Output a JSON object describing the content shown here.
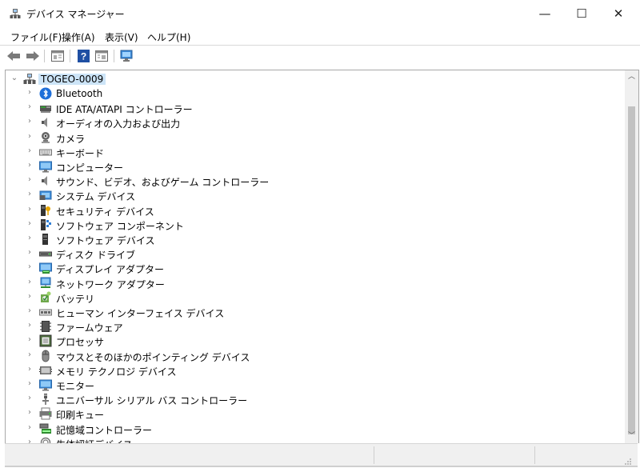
{
  "window": {
    "title": "デバイス マネージャー",
    "minimize": "—",
    "maximize": "☐",
    "close": "✕"
  },
  "menu": [
    {
      "label": "ファイル(F)"
    },
    {
      "label": "操作(A)"
    },
    {
      "label": "表示(V)"
    },
    {
      "label": "ヘルプ(H)"
    }
  ],
  "toolbar": {
    "buttons": [
      {
        "name": "back-icon"
      },
      {
        "name": "forward-icon"
      },
      {
        "name": "properties-view-icon"
      },
      {
        "name": "help-icon"
      },
      {
        "name": "action-view-icon"
      },
      {
        "name": "monitor-scan-icon"
      }
    ]
  },
  "tree": {
    "root": {
      "label": "TOGEO-0009",
      "icon": "computer-network-icon",
      "expanded": true
    },
    "items": [
      {
        "label": "Bluetooth",
        "icon": "bluetooth-icon"
      },
      {
        "label": "IDE ATA/ATAPI コントローラー",
        "icon": "ide-controller-icon"
      },
      {
        "label": "オーディオの入力および出力",
        "icon": "speaker-icon"
      },
      {
        "label": "カメラ",
        "icon": "camera-icon"
      },
      {
        "label": "キーボード",
        "icon": "keyboard-icon"
      },
      {
        "label": "コンピューター",
        "icon": "computer-icon"
      },
      {
        "label": "サウンド、ビデオ、およびゲーム コントローラー",
        "icon": "sound-icon"
      },
      {
        "label": "システム デバイス",
        "icon": "system-device-icon"
      },
      {
        "label": "セキュリティ デバイス",
        "icon": "security-key-icon"
      },
      {
        "label": "ソフトウェア コンポーネント",
        "icon": "software-component-icon"
      },
      {
        "label": "ソフトウェア デバイス",
        "icon": "software-device-icon"
      },
      {
        "label": "ディスク ドライブ",
        "icon": "disk-drive-icon"
      },
      {
        "label": "ディスプレイ アダプター",
        "icon": "display-adapter-icon"
      },
      {
        "label": "ネットワーク アダプター",
        "icon": "network-adapter-icon"
      },
      {
        "label": "バッテリ",
        "icon": "battery-icon"
      },
      {
        "label": "ヒューマン インターフェイス デバイス",
        "icon": "hid-icon"
      },
      {
        "label": "ファームウェア",
        "icon": "firmware-icon"
      },
      {
        "label": "プロセッサ",
        "icon": "processor-icon"
      },
      {
        "label": "マウスとそのほかのポインティング デバイス",
        "icon": "mouse-icon"
      },
      {
        "label": "メモリ テクノロジ デバイス",
        "icon": "memory-icon"
      },
      {
        "label": "モニター",
        "icon": "monitor-icon"
      },
      {
        "label": "ユニバーサル シリアル バス コントローラー",
        "icon": "usb-icon"
      },
      {
        "label": "印刷キュー",
        "icon": "printer-icon"
      },
      {
        "label": "記憶域コントローラー",
        "icon": "storage-controller-icon"
      },
      {
        "label": "生体認証デバイス",
        "icon": "biometric-icon"
      }
    ]
  }
}
